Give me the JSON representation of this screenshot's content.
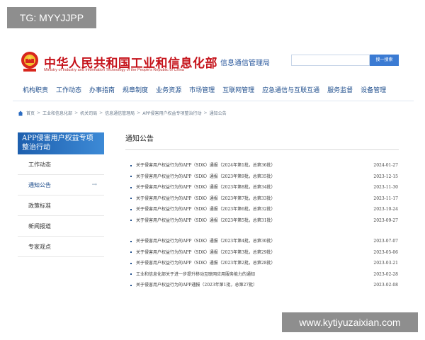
{
  "watermarks": {
    "top": "TG: MYYJJPP",
    "bottom": "www.kytiyuzaixian.com"
  },
  "header": {
    "title": "中华人民共和国工业和信息化部",
    "subtitle": "Ministry of Industry and Information Technology of the People's Republic of China",
    "site_name": "信息通信管理局",
    "search_button": "搜一搜索",
    "search_placeholder": ""
  },
  "nav": [
    "机构职责",
    "工作动态",
    "办事指南",
    "规章制度",
    "业务资源",
    "市场管理",
    "互联网管理",
    "应急通信与互联互通",
    "服务监督",
    "设备管理"
  ],
  "breadcrumb": [
    "首页",
    "工业和信息化部",
    "机关司局",
    "信息通信管理局",
    "APP侵害用户权益专项整治行动",
    "通知公告"
  ],
  "sidebar": {
    "banner": "APP侵害用户权益专项整治行动",
    "items": [
      {
        "label": "工作动态"
      },
      {
        "label": "通知公告",
        "arrow": "→"
      },
      {
        "label": "政策标准"
      },
      {
        "label": "新闻报道"
      },
      {
        "label": "专家观点"
      }
    ]
  },
  "main": {
    "title": "通知公告",
    "group1": [
      {
        "text": "关于侵害用户权益行为的APP（SDK）通报（2024年第1批，总第36批）",
        "date": "2024-01-27"
      },
      {
        "text": "关于侵害用户权益行为的APP（SDK）通报（2023年第9批，总第35批）",
        "date": "2023-12-15"
      },
      {
        "text": "关于侵害用户权益行为的APP（SDK）通报（2023年第8批，总第34批）",
        "date": "2023-11-30"
      },
      {
        "text": "关于侵害用户权益行为的APP（SDK）通报（2023年第7批，总第33批）",
        "date": "2023-11-17"
      },
      {
        "text": "关于侵害用户权益行为的APP（SDK）通报（2023年第6批，总第32批）",
        "date": "2023-10-24"
      },
      {
        "text": "关于侵害用户权益行为的APP（SDK）通报（2023年第5批，总第31批）",
        "date": "2023-09-27"
      }
    ],
    "group2": [
      {
        "text": "关于侵害用户权益行为的APP（SDK）通报（2023年第4批，总第30批）",
        "date": "2023-07-07"
      },
      {
        "text": "关于侵害用户权益行为的APP（SDK）通报（2023年第3批，总第29批）",
        "date": "2023-05-06"
      },
      {
        "text": "关于侵害用户权益行为的APP（SDK）通报（2023年第2批，总第28批）",
        "date": "2023-03-21"
      },
      {
        "text": "工业和信息化部关于进一步提升移动互联网应用服务能力的通知",
        "date": "2023-02-28"
      },
      {
        "text": "关于侵害用户权益行为的APP通报（2023年第1批，总第27批）",
        "date": "2023-02-08"
      }
    ]
  }
}
